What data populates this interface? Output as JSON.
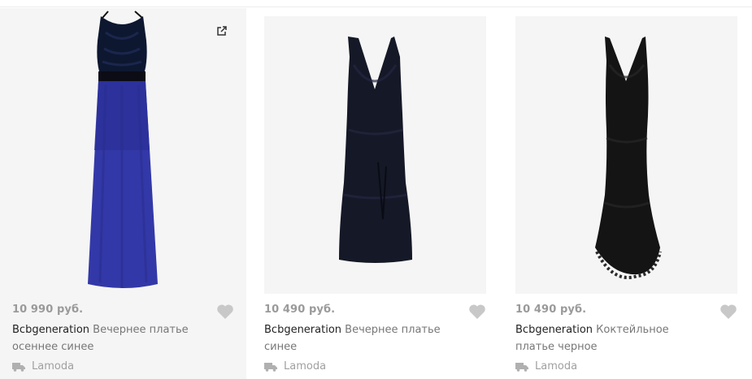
{
  "products": [
    {
      "price": "10 990 руб.",
      "brand": "Bcbgeneration",
      "name": "Вечернее платье осеннее синее",
      "seller": "Lamoda",
      "icons": [
        "external-link-icon",
        "heart-icon",
        "truck-icon"
      ],
      "image_description_colors": {
        "bodice": "#0d1730",
        "skirt": "#3338a8"
      }
    },
    {
      "price": "10 490 руб.",
      "brand": "Bcbgeneration",
      "name": "Вечернее платье синее",
      "seller": "Lamoda",
      "icons": [
        "heart-icon",
        "truck-icon"
      ],
      "image_description_colors": {
        "dress": "#151826"
      }
    },
    {
      "price": "10 490 руб.",
      "brand": "Bcbgeneration",
      "name": "Коктейльное платье черное",
      "seller": "Lamoda",
      "icons": [
        "heart-icon",
        "truck-icon"
      ],
      "image_description_colors": {
        "dress": "#141414"
      }
    }
  ],
  "colors": {
    "price": "#9a9a9a",
    "heart": "#c8c8c8",
    "card_bg": "#f5f5f5"
  }
}
